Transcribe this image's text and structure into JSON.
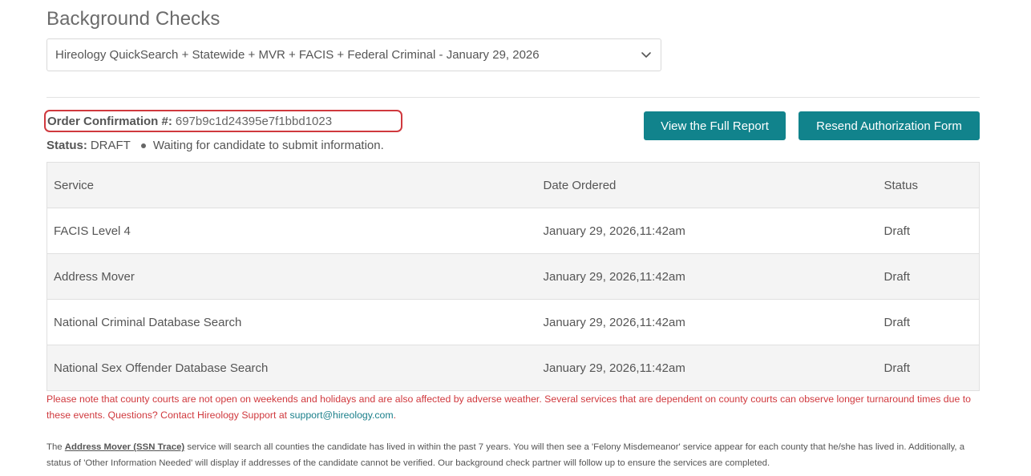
{
  "page": {
    "title": "Background Checks"
  },
  "package_select": {
    "selected": "Hireology QuickSearch + Statewide + MVR + FACIS + Federal Criminal - January 29, 2026",
    "icon": "chevron-down-icon"
  },
  "order": {
    "label": "Order Confirmation #:",
    "value": "697b9c1d24395e7f1bbd1023"
  },
  "status": {
    "label": "Status:",
    "value": "DRAFT",
    "message": "Waiting for candidate to submit information."
  },
  "buttons": {
    "view_report": "View the Full Report",
    "resend_form": "Resend Authorization Form"
  },
  "table": {
    "headers": {
      "service": "Service",
      "date": "Date Ordered",
      "status": "Status"
    },
    "rows": [
      {
        "service": "FACIS Level 4",
        "date": "January 29, 2026,11:42am",
        "status": "Draft"
      },
      {
        "service": "Address Mover",
        "date": "January 29, 2026,11:42am",
        "status": "Draft"
      },
      {
        "service": "National Criminal Database Search",
        "date": "January 29, 2026,11:42am",
        "status": "Draft"
      },
      {
        "service": "National Sex Offender Database Search",
        "date": "January 29, 2026,11:42am",
        "status": "Draft"
      }
    ]
  },
  "notice": {
    "text": "Please note that county courts are not open on weekends and holidays and are also affected by adverse weather. Several services that are dependent on county courts can observe longer turnaround times due to these events. Questions? Contact Hireology Support at ",
    "email": "support@hireology.com",
    "end": "."
  },
  "info": {
    "prefix": "The ",
    "link": "Address Mover (SSN Trace)",
    "text": " service will search all counties the candidate has lived in within the past 7 years. You will then see a 'Felony Misdemeanor' service appear for each county that he/she has lived in. Additionally, a status of 'Other Information Needed' will display if addresses of the candidate cannot be verified. Our background check partner will follow up to ensure the services are completed."
  },
  "colors": {
    "accent": "#11838c",
    "highlight_border": "#d0393e",
    "notice_text": "#d0393e",
    "link": "#1a7f8a"
  }
}
